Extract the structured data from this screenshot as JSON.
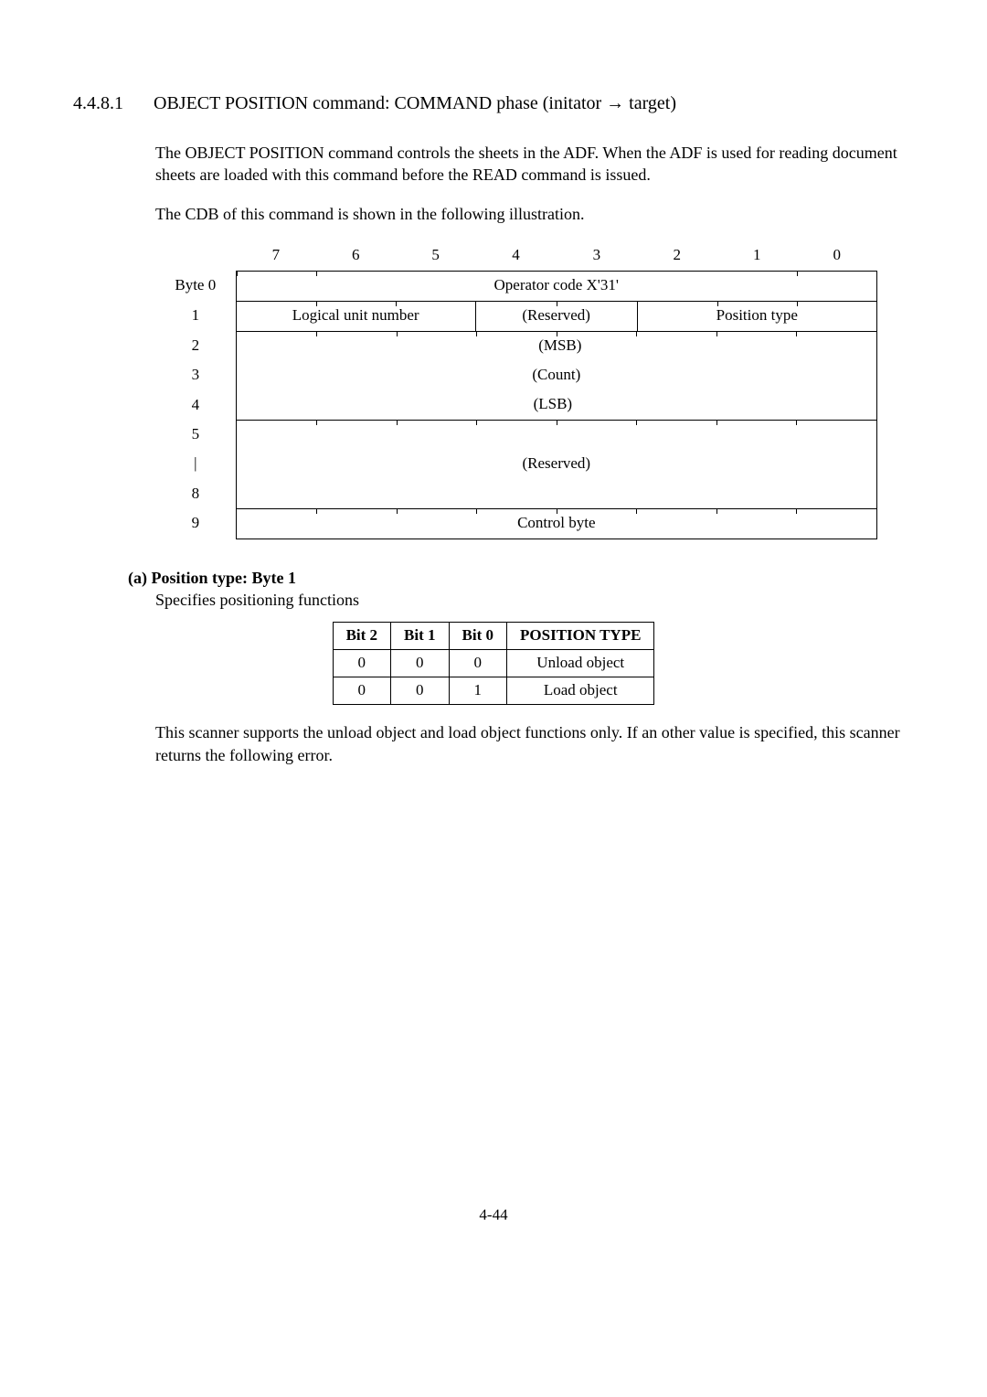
{
  "section": {
    "number": "4.4.8.1",
    "title_a": "OBJECT POSITION command: COMMAND phase (initator ",
    "title_b": " target)"
  },
  "para1": "The OBJECT POSITION command controls the sheets in the ADF. When the ADF is used for reading document sheets are loaded with this command before the READ command is issued.",
  "para2": "The CDB of this command is shown in the following illustration.",
  "cdb": {
    "bit_headers": [
      "7",
      "6",
      "5",
      "4",
      "3",
      "2",
      "1",
      "0"
    ],
    "byte_labels": [
      "Byte 0",
      "1",
      "2",
      "3",
      "4",
      "5",
      "",
      "8",
      "9"
    ],
    "row0": "Operator code X'31'",
    "row1_a": "Logical unit number",
    "row1_b": "(Reserved)",
    "row1_c": "Position type",
    "msb": "(MSB)",
    "count": "(Count)",
    "lsb": "(LSB)",
    "reserved2": "(Reserved)",
    "control": "Control byte"
  },
  "subsection": {
    "heading": "(a) Position type: Byte 1",
    "desc": "Specifies positioning functions"
  },
  "ptype_table": {
    "headers": [
      "Bit 2",
      "Bit 1",
      "Bit 0",
      "POSITION TYPE"
    ],
    "rows": [
      {
        "b2": "0",
        "b1": "0",
        "b0": "0",
        "pt": "Unload object"
      },
      {
        "b2": "0",
        "b1": "0",
        "b0": "1",
        "pt": "Load object"
      }
    ]
  },
  "para3": "This scanner supports the unload object and load object functions only. If an other value is specified, this scanner returns the following error.",
  "page_number": "4-44"
}
